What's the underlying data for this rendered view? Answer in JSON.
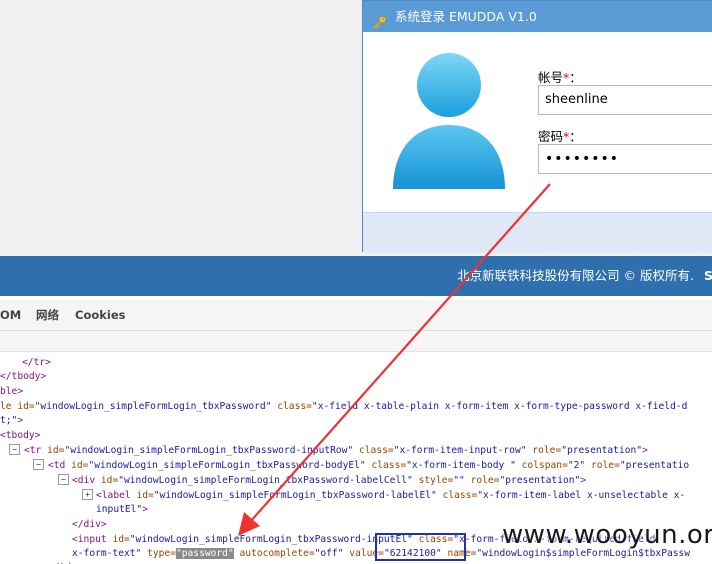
{
  "login_window": {
    "title": "系统登录 EMUDDA V1.0",
    "username_label": "帐号",
    "password_label": "密码",
    "required_mark": "*",
    "label_suffix": "：",
    "username_value": "sheenline",
    "password_mask": "••••••••"
  },
  "copyright": {
    "text": "北京新联铁科技股份有限公司 © 版权所有.",
    "tail": "S"
  },
  "devtools": {
    "tabs": [
      "OM",
      "网络",
      "Cookies"
    ],
    "lines": [
      {
        "id": "l1",
        "parts": [
          [
            "t",
            "</tr>"
          ]
        ]
      },
      {
        "id": "l2",
        "parts": [
          [
            "t",
            "</tbody>"
          ]
        ]
      },
      {
        "id": "l3",
        "parts": [
          [
            "t",
            "ble>"
          ]
        ]
      },
      {
        "id": "l4",
        "parts": [
          [
            "a",
            "le id="
          ],
          [
            "v",
            "\"windowLogin_simpleFormLogin_tbxPassword\""
          ],
          [
            "a",
            " class="
          ],
          [
            "v",
            "\"x-field x-table-plain x-form-item x-form-type-password x-field-d"
          ]
        ]
      },
      {
        "id": "l5",
        "parts": [
          [
            "v",
            "t;\""
          ],
          [
            "t",
            ">"
          ]
        ]
      },
      {
        "id": "l6",
        "parts": [
          [
            "t",
            "<tbody>"
          ]
        ]
      },
      {
        "id": "l7",
        "parts": [
          [
            "t",
            "<tr "
          ],
          [
            "a",
            "id="
          ],
          [
            "v",
            "\"windowLogin_simpleFormLogin_tbxPassword-inputRow\""
          ],
          [
            "a",
            " class="
          ],
          [
            "v",
            "\"x-form-item-input-row\""
          ],
          [
            "a",
            " role="
          ],
          [
            "v",
            "\"presentation\""
          ],
          [
            "t",
            ">"
          ]
        ]
      },
      {
        "id": "l8",
        "parts": [
          [
            "t",
            "<td "
          ],
          [
            "a",
            "id="
          ],
          [
            "v",
            "\"windowLogin_simpleFormLogin_tbxPassword-bodyEl\""
          ],
          [
            "a",
            " class="
          ],
          [
            "v",
            "\"x-form-item-body \""
          ],
          [
            "a",
            " colspan="
          ],
          [
            "v",
            "\"2\""
          ],
          [
            "a",
            " role="
          ],
          [
            "v",
            "\"presentatio"
          ]
        ]
      },
      {
        "id": "l9",
        "parts": [
          [
            "t",
            "<div "
          ],
          [
            "a",
            "id="
          ],
          [
            "v",
            "\"windowLogin_simpleFormLogin_tbxPassword-labelCell\""
          ],
          [
            "a",
            " style="
          ],
          [
            "v",
            "\"\""
          ],
          [
            "a",
            " role="
          ],
          [
            "v",
            "\"presentation\""
          ],
          [
            "t",
            ">"
          ]
        ]
      },
      {
        "id": "l10",
        "parts": [
          [
            "t",
            "<label "
          ],
          [
            "a",
            "id="
          ],
          [
            "v",
            "\"windowLogin_simpleFormLogin_tbxPassword-labelEl\""
          ],
          [
            "a",
            " class="
          ],
          [
            "v",
            "\"x-form-item-label x-unselectable x-"
          ]
        ]
      },
      {
        "id": "l11",
        "parts": [
          [
            "v",
            "inputEl\""
          ],
          [
            "t",
            ">"
          ]
        ]
      },
      {
        "id": "l12",
        "parts": [
          [
            "t",
            "</div>"
          ]
        ]
      },
      {
        "id": "l13",
        "parts": [
          [
            "t",
            "<input "
          ],
          [
            "a",
            "id="
          ],
          [
            "v",
            "\"windowLogin_simpleFormLogin_tbxPassword-inputEl\""
          ],
          [
            "a",
            " class="
          ],
          [
            "v",
            "\"x-form-field x-form-required-field"
          ]
        ]
      },
      {
        "id": "l14",
        "parts": [
          [
            "v",
            "x-form-text\""
          ],
          [
            "a",
            " type="
          ],
          [
            "sel",
            "\"password\""
          ],
          [
            "a",
            " autocomplete="
          ],
          [
            "v",
            "\"off\""
          ],
          [
            "a",
            " value="
          ],
          [
            "v",
            "\"62142100\""
          ],
          [
            "a",
            " name="
          ],
          [
            "v",
            "\"windowLogin$simpleFormLogin$tbxPassw"
          ]
        ]
      },
      {
        "id": "l15",
        "parts": [
          [
            "t",
            "</td>"
          ]
        ]
      }
    ]
  },
  "watermark": "www.wooyun.org",
  "colors": {
    "title_bar": "#5a9bd5",
    "copyright_bar": "#2f6fae",
    "arrow": "#ee3333",
    "highlight_box": "#2233aa",
    "avatar_light": "#6fcdf2",
    "avatar_dark": "#1aa0dc"
  }
}
